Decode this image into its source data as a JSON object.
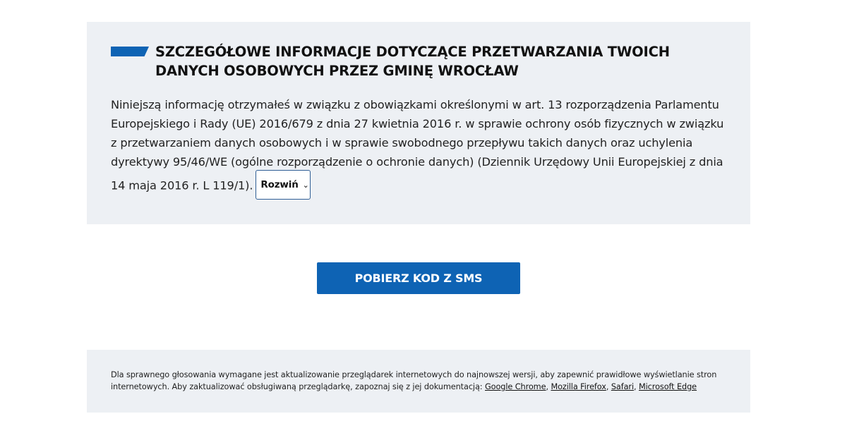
{
  "info": {
    "title": "SZCZEGÓŁOWE INFORMACJE DOTYCZĄCE PRZETWARZANIA TWOICH DANYCH OSOBOWYCH PRZEZ GMINĘ WROCŁAW",
    "body": "Niniejszą informację otrzymałeś w związku z obowiązkami określonymi w art. 13 rozporządzenia Parlamentu Europejskiego i Rady (UE) 2016/679 z dnia 27 kwietnia 2016 r. w sprawie ochrony osób fizycznych w związku z przetwarzaniem danych osobowych i w sprawie swobodnego przepływu takich danych oraz uchylenia dyrektywy 95/46/WE (ogólne rozporządzenie o ochronie danych) (Dziennik Urzędowy Unii Europejskiej z dnia 14 maja 2016 r. L 119/1).",
    "expand_label": "Rozwiń",
    "expand_icon": "chevron-down-icon"
  },
  "action": {
    "sms_button_label": "POBIERZ KOD Z SMS"
  },
  "footer": {
    "text_part1": "Dla sprawnego głosowania wymagane jest aktualizowanie przeglądarek internetowych do najnowszej wersji, aby zapewnić prawidłowe wyświetlanie stron internetowych. Aby zaktualizować obsługiwaną przeglądarkę, zapoznaj się z jej dokumentacją: ",
    "links": [
      "Google Chrome",
      "Mozilla Firefox",
      "Safari",
      "Microsoft Edge"
    ],
    "separator": ", "
  },
  "colors": {
    "accent": "#0e63b4",
    "panel_background": "#edf0f4"
  }
}
